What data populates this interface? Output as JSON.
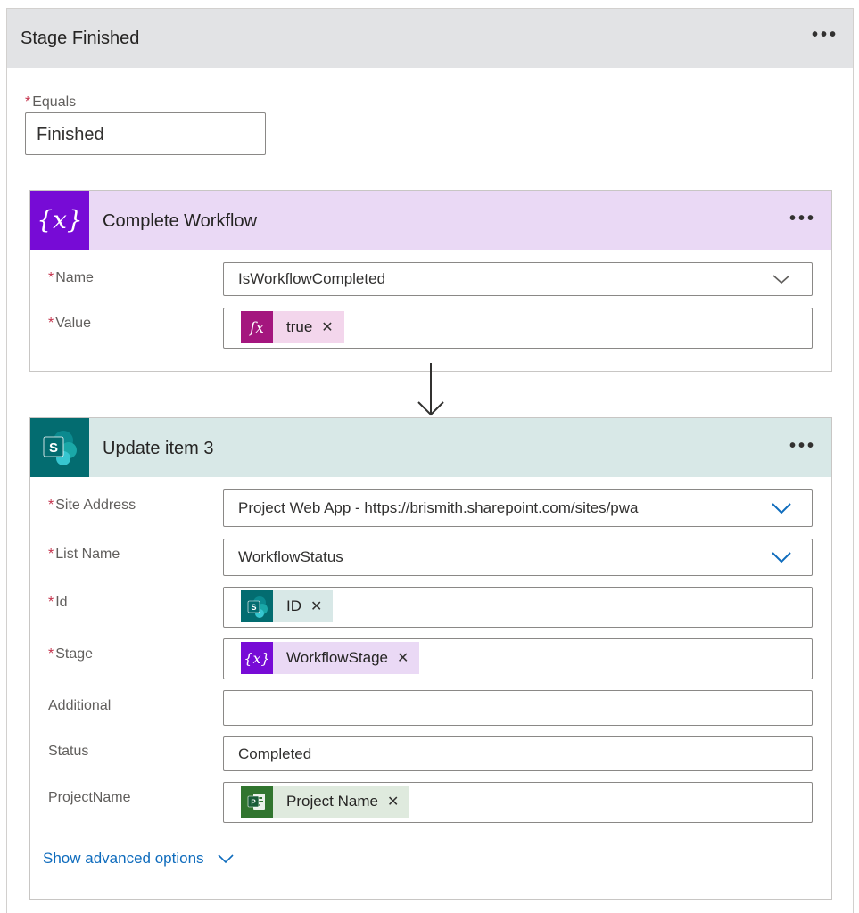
{
  "case": {
    "title": "Stage Finished",
    "equals_label": "Equals",
    "equals_value": "Finished"
  },
  "complete_workflow": {
    "title": "Complete Workflow",
    "icon": "variable-icon",
    "name_label": "Name",
    "name_value": "IsWorkflowCompleted",
    "value_label": "Value",
    "value_token": "true",
    "value_token_icon": "fx-icon"
  },
  "update_item": {
    "title": "Update item 3",
    "icon": "sharepoint-icon",
    "site_address_label": "Site Address",
    "site_address_value": "Project Web App - https://brismith.sharepoint.com/sites/pwa",
    "list_name_label": "List Name",
    "list_name_value": "WorkflowStatus",
    "id_label": "Id",
    "id_token": "ID",
    "stage_label": "Stage",
    "stage_token": "WorkflowStage",
    "additional_label": "Additional",
    "additional_value": "",
    "status_label": "Status",
    "status_value": "Completed",
    "project_name_label": "ProjectName",
    "project_name_token": "Project Name",
    "advanced_link": "Show advanced options"
  },
  "colors": {
    "variable_purple": "#770bd6",
    "variable_header": "#ead9f5",
    "expression_magenta": "#a4167e",
    "sharepoint_teal": "#036c70",
    "sharepoint_header": "#d8e8e7",
    "project_green": "#31752f",
    "link_blue": "#0f6cbd"
  }
}
